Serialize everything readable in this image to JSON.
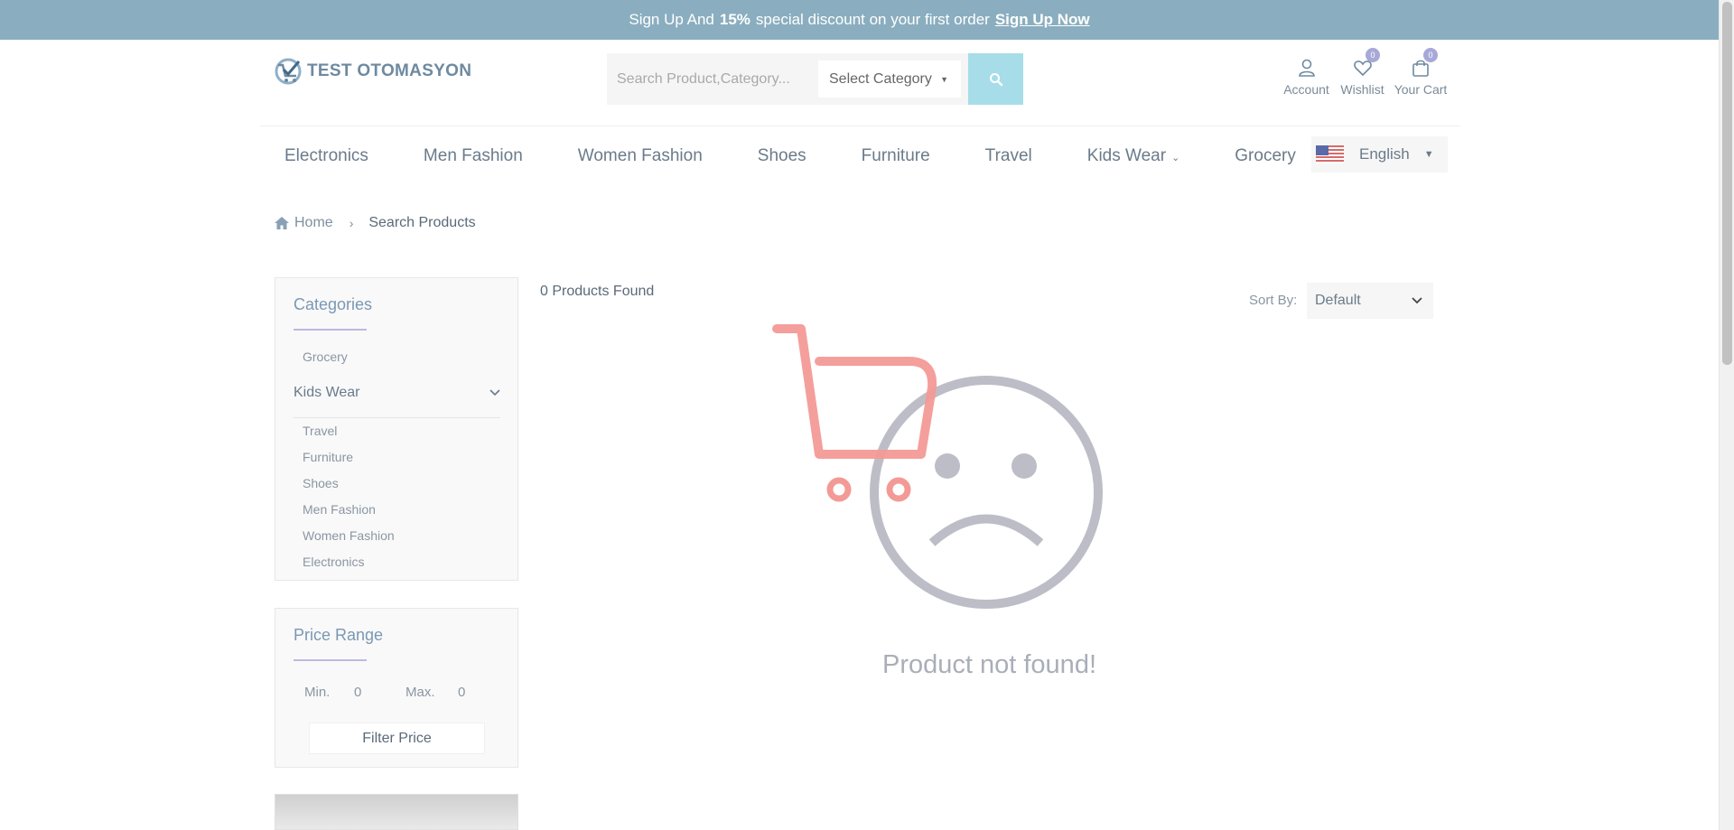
{
  "promo": {
    "text_before": "Sign Up And",
    "highlight": "15%",
    "text_after": "special discount on your first order",
    "link": "Sign Up Now",
    "bg_color": "#8aaebf"
  },
  "header": {
    "logo_text": "TEST OTOMASYON",
    "search": {
      "placeholder": "Search Product,Category...",
      "category_select": "Select Category",
      "button_icon": "search-icon"
    },
    "icons": [
      {
        "label": "Account",
        "icon": "user-icon"
      },
      {
        "label": "Wishlist",
        "icon": "heart-icon",
        "badge": "0"
      },
      {
        "label": "Your Cart",
        "icon": "bag-icon",
        "badge": "0"
      }
    ]
  },
  "nav": {
    "items": [
      "Electronics",
      "Men Fashion",
      "Women Fashion",
      "Shoes",
      "Furniture",
      "Travel",
      "Kids Wear",
      "Grocery"
    ],
    "language": "English"
  },
  "breadcrumb": {
    "home": "Home",
    "current": "Search Products"
  },
  "sidebar": {
    "categories_title": "Categories",
    "top_category": "Grocery",
    "expanded_category": "Kids Wear",
    "sub_categories": [
      "Travel",
      "Furniture",
      "Shoes",
      "Men Fashion",
      "Women Fashion",
      "Electronics"
    ],
    "price_title": "Price Range",
    "price": {
      "min_label": "Min.",
      "min_value": "0",
      "max_label": "Max.",
      "max_value": "0",
      "button": "Filter Price"
    }
  },
  "results": {
    "count_text": "0 Products Found",
    "sort_label": "Sort By:",
    "sort_value": "Default",
    "empty_message": "Product not found!",
    "empty_icon": "sad-cart-icon"
  }
}
